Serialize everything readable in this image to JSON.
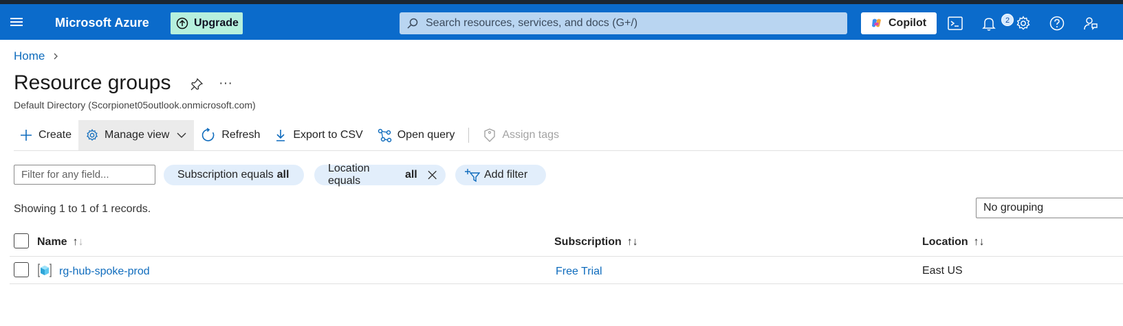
{
  "topbar": {
    "brand": "Microsoft Azure",
    "upgrade_label": "Upgrade",
    "search_placeholder": "Search resources, services, and docs (G+/)",
    "copilot_label": "Copilot",
    "notification_count": "2",
    "icons": [
      "hamburger-icon",
      "cloud-shell-icon",
      "bell-icon",
      "gear-icon",
      "help-icon",
      "feedback-icon"
    ]
  },
  "breadcrumb": {
    "home": "Home",
    "separator": ">"
  },
  "page": {
    "title": "Resource groups",
    "more": "···",
    "subtitle": "Default Directory (Scorpionet05outlook.onmicrosoft.com)"
  },
  "toolbar": {
    "create": "Create",
    "manage_view": "Manage view",
    "refresh": "Refresh",
    "export_csv": "Export to CSV",
    "open_query": "Open query",
    "assign_tags": "Assign tags"
  },
  "filters": {
    "placeholder": "Filter for any field...",
    "subscription_label": "Subscription equals",
    "subscription_value": "all",
    "location_label": "Location equals",
    "location_value": "all",
    "add_filter": "Add filter"
  },
  "records_text": "Showing 1 to 1 of 1 records.",
  "grouping": "No grouping",
  "table": {
    "columns": {
      "name": "Name",
      "subscription": "Subscription",
      "location": "Location"
    },
    "rows": [
      {
        "name": "rg-hub-spoke-prod",
        "subscription": "Free Trial",
        "location": "East US"
      }
    ]
  },
  "colors": {
    "header_bg": "#0b6bcb",
    "link": "#0f6cbd",
    "pill_bg": "#e2eefb",
    "upgrade_bg": "#b6f0dd"
  }
}
